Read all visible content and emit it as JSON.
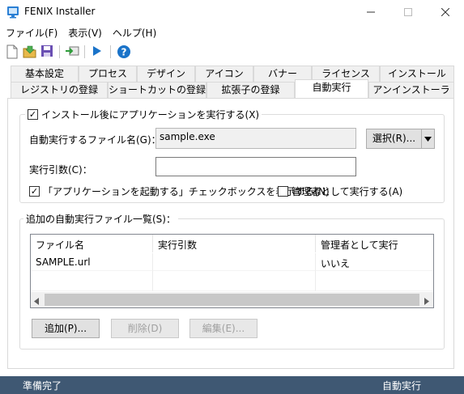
{
  "app": {
    "title": "FENIX Installer"
  },
  "menu": [
    {
      "label": "ファイル(F)"
    },
    {
      "label": "表示(V)"
    },
    {
      "label": "ヘルプ(H)"
    }
  ],
  "toolbar": {
    "icons": [
      "new-file-icon",
      "open-folder-icon",
      "save-icon",
      "import-icon",
      "run-icon",
      "help-icon"
    ]
  },
  "tabs": {
    "row1": [
      "基本設定",
      "プロセス",
      "デザイン",
      "アイコン",
      "バナー",
      "ライセンス",
      "インストール"
    ],
    "row2": [
      "レジストリの登録",
      "ショートカットの登録",
      "拡張子の登録",
      "自動実行",
      "アンインストーラ"
    ],
    "active": "自動実行"
  },
  "autorun": {
    "enable_label": "インストール後にアプリケーションを実行する(X)",
    "enable_checked": true,
    "file_label": "自動実行するファイル名(G)：",
    "file_value": "sample.exe",
    "select_button": "選択(R)...",
    "args_label": "実行引数(C)：",
    "args_value": "",
    "show_checkbox_label": "「アプリケーションを起動する」チェックボックスを表示する(N)",
    "show_checkbox_checked": true,
    "run_as_admin_label": "管理者として実行する(A)",
    "run_as_admin_checked": false
  },
  "additional": {
    "group_label": "追加の自動実行ファイル一覧(S)：",
    "columns": [
      "ファイル名",
      "実行引数",
      "管理者として実行"
    ],
    "rows": [
      [
        "SAMPLE.url",
        "",
        "いいえ"
      ]
    ],
    "buttons": {
      "add": "追加(P)...",
      "delete": "削除(D)",
      "edit": "編集(E)..."
    }
  },
  "status": {
    "left": "準備完了",
    "right": "自動実行"
  },
  "colors": {
    "statusbar": "#3f5873",
    "accent": "#1a73c9"
  }
}
